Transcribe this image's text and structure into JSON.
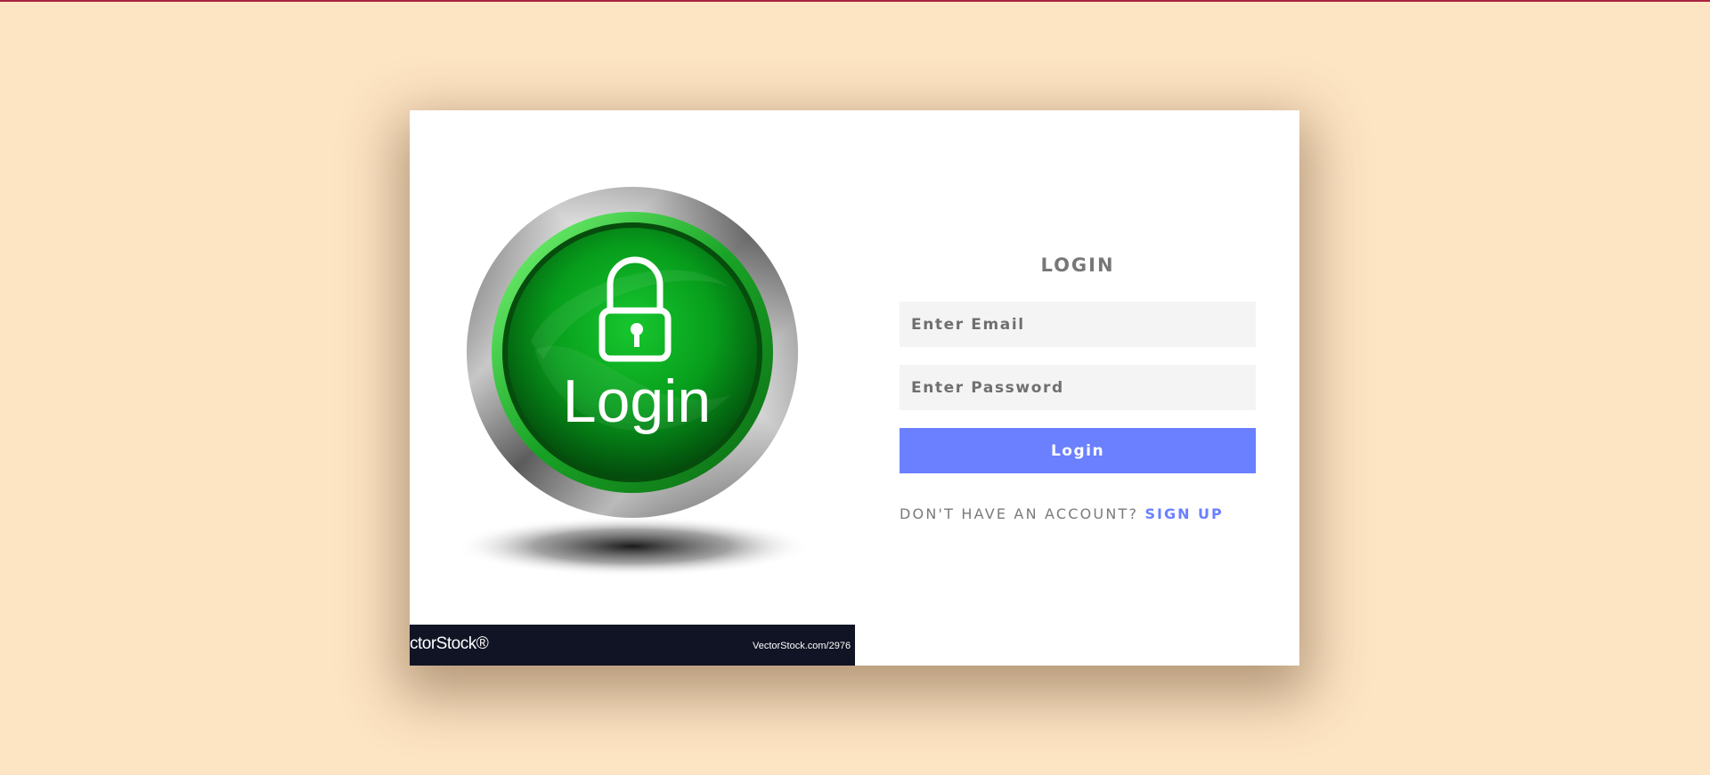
{
  "colors": {
    "background": "#fde4c3",
    "card": "#ffffff",
    "accent": "#6a80ff",
    "top_line": "#a8243f",
    "watermark_bar": "#111424",
    "button_green": "#06a61e"
  },
  "illustration": {
    "button_text": "Login",
    "icon": "lock-icon",
    "watermark_logo": "ctorStock®",
    "watermark_url": "VectorStock.com/2976"
  },
  "form": {
    "title": "LOGIN",
    "email_placeholder": "Enter Email",
    "password_placeholder": "Enter Password",
    "submit_label": "Login",
    "signup_prompt": "DON'T HAVE AN ACCOUNT?",
    "signup_link": "SIGN UP"
  }
}
